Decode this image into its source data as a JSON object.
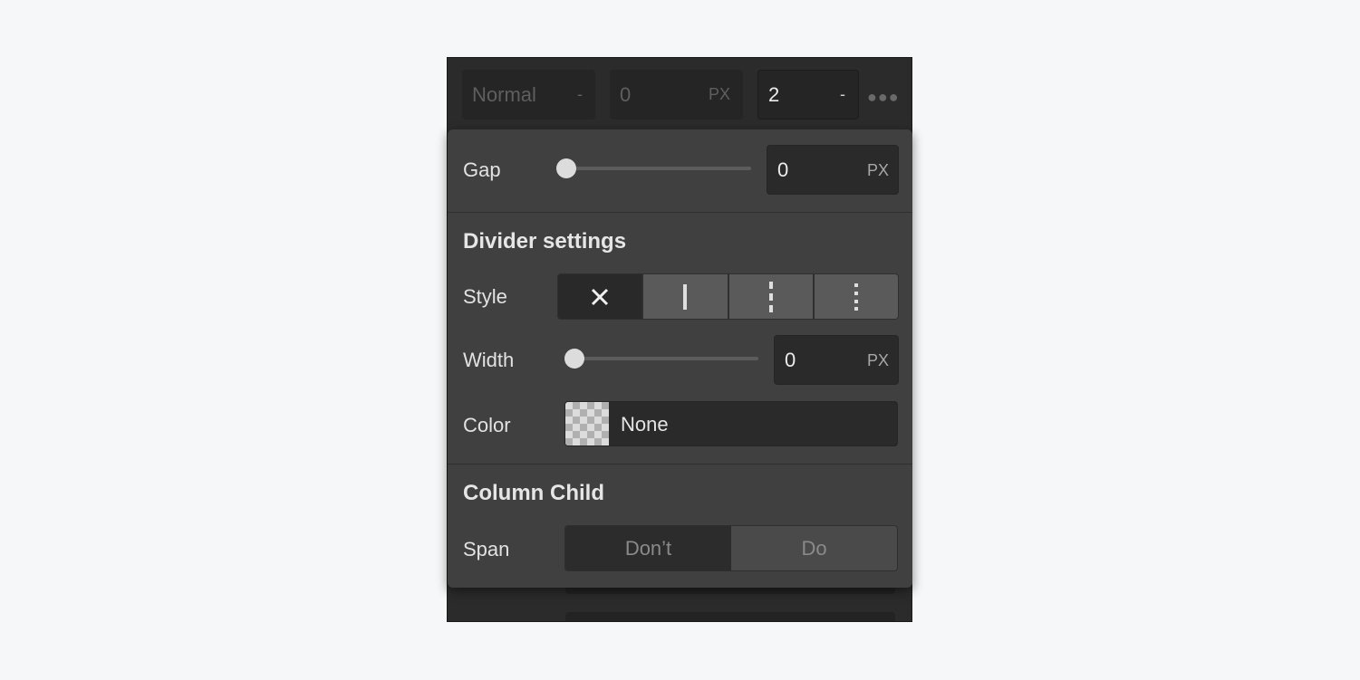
{
  "top_row": {
    "blend_value": "Normal",
    "blend_suffix": "-",
    "offset_value": "0",
    "offset_unit": "PX",
    "columns_value": "2",
    "columns_suffix": "-",
    "more_icon": "ellipsis-icon"
  },
  "gap": {
    "label": "Gap",
    "slider_fraction": 0,
    "value": "0",
    "unit": "PX"
  },
  "divider_settings": {
    "heading": "Divider settings",
    "style": {
      "label": "Style",
      "options": [
        {
          "name": "none",
          "icon": "close-icon",
          "active": true
        },
        {
          "name": "solid",
          "icon": "solid-line-icon",
          "active": false
        },
        {
          "name": "dashed",
          "icon": "dashed-line-icon",
          "active": false
        },
        {
          "name": "dotted",
          "icon": "dotted-line-icon",
          "active": false
        }
      ]
    },
    "width": {
      "label": "Width",
      "slider_fraction": 0,
      "value": "0",
      "unit": "PX"
    },
    "color": {
      "label": "Color",
      "value": "None"
    }
  },
  "column_child": {
    "heading": "Column Child",
    "span": {
      "label": "Span",
      "options": [
        "Don’t",
        "Do"
      ],
      "selected": "Don’t"
    }
  }
}
